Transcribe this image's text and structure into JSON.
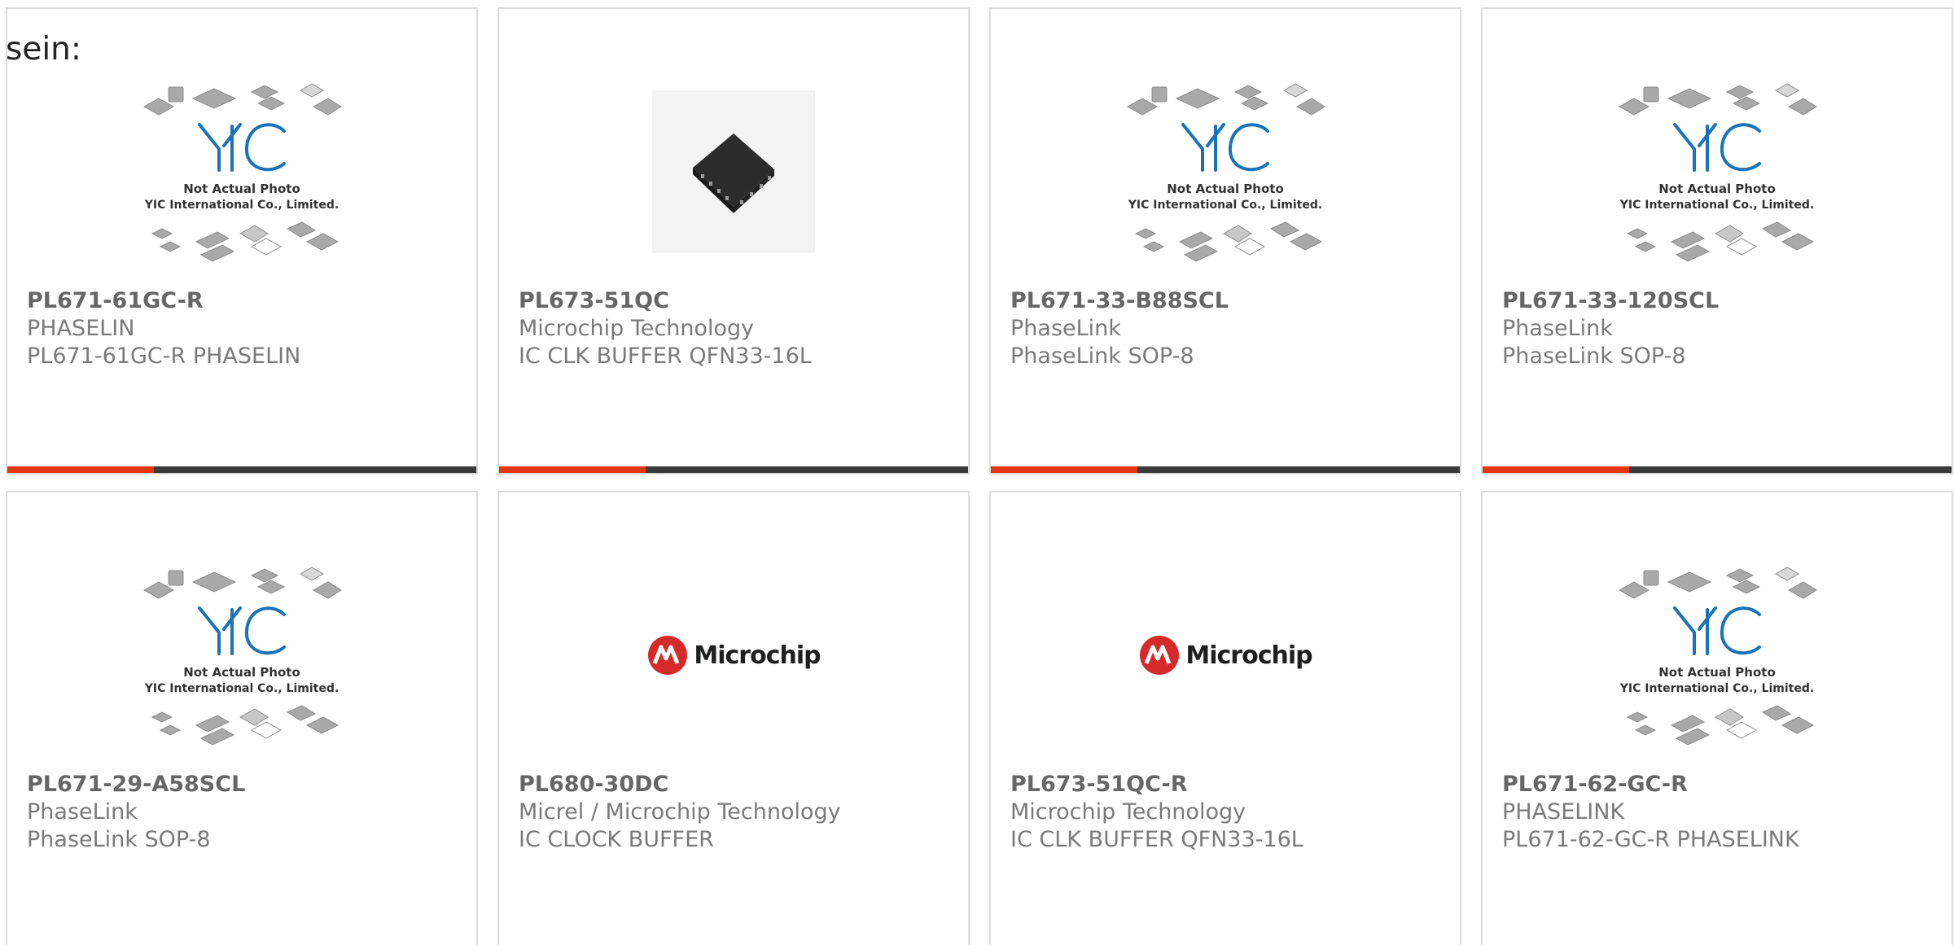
{
  "intro_text": "sein:",
  "colors": {
    "accent": "#e5360f",
    "bar": "#3a3a3a",
    "yic_blue": "#1a73b8",
    "microchip_red": "#d62a2a"
  },
  "placeholder": {
    "line1": "Not Actual Photo",
    "line2": "YIC International Co., Limited.",
    "logo": "YIC"
  },
  "microchip_logo_text": "Microchip",
  "products": [
    {
      "part": "PL671-61GC-R",
      "maker": "PHASELIN",
      "desc": "PL671-61GC-R PHASELIN",
      "image": "yic-placeholder"
    },
    {
      "part": "PL673-51QC",
      "maker": "Microchip Technology",
      "desc": "IC CLK BUFFER QFN33-16L",
      "image": "chip-photo"
    },
    {
      "part": "PL671-33-B88SCL",
      "maker": "PhaseLink",
      "desc": "PhaseLink SOP-8",
      "image": "yic-placeholder"
    },
    {
      "part": "PL671-33-120SCL",
      "maker": "PhaseLink",
      "desc": "PhaseLink SOP-8",
      "image": "yic-placeholder"
    },
    {
      "part": "PL671-29-A58SCL",
      "maker": "PhaseLink",
      "desc": "PhaseLink SOP-8",
      "image": "yic-placeholder"
    },
    {
      "part": "PL680-30DC",
      "maker": "Micrel / Microchip Technology",
      "desc": "IC CLOCK BUFFER",
      "image": "microchip-logo"
    },
    {
      "part": "PL673-51QC-R",
      "maker": "Microchip Technology",
      "desc": "IC CLK BUFFER QFN33-16L",
      "image": "microchip-logo"
    },
    {
      "part": "PL671-62-GC-R",
      "maker": "PHASELINK",
      "desc": "PL671-62-GC-R PHASELINK",
      "image": "yic-placeholder"
    }
  ]
}
